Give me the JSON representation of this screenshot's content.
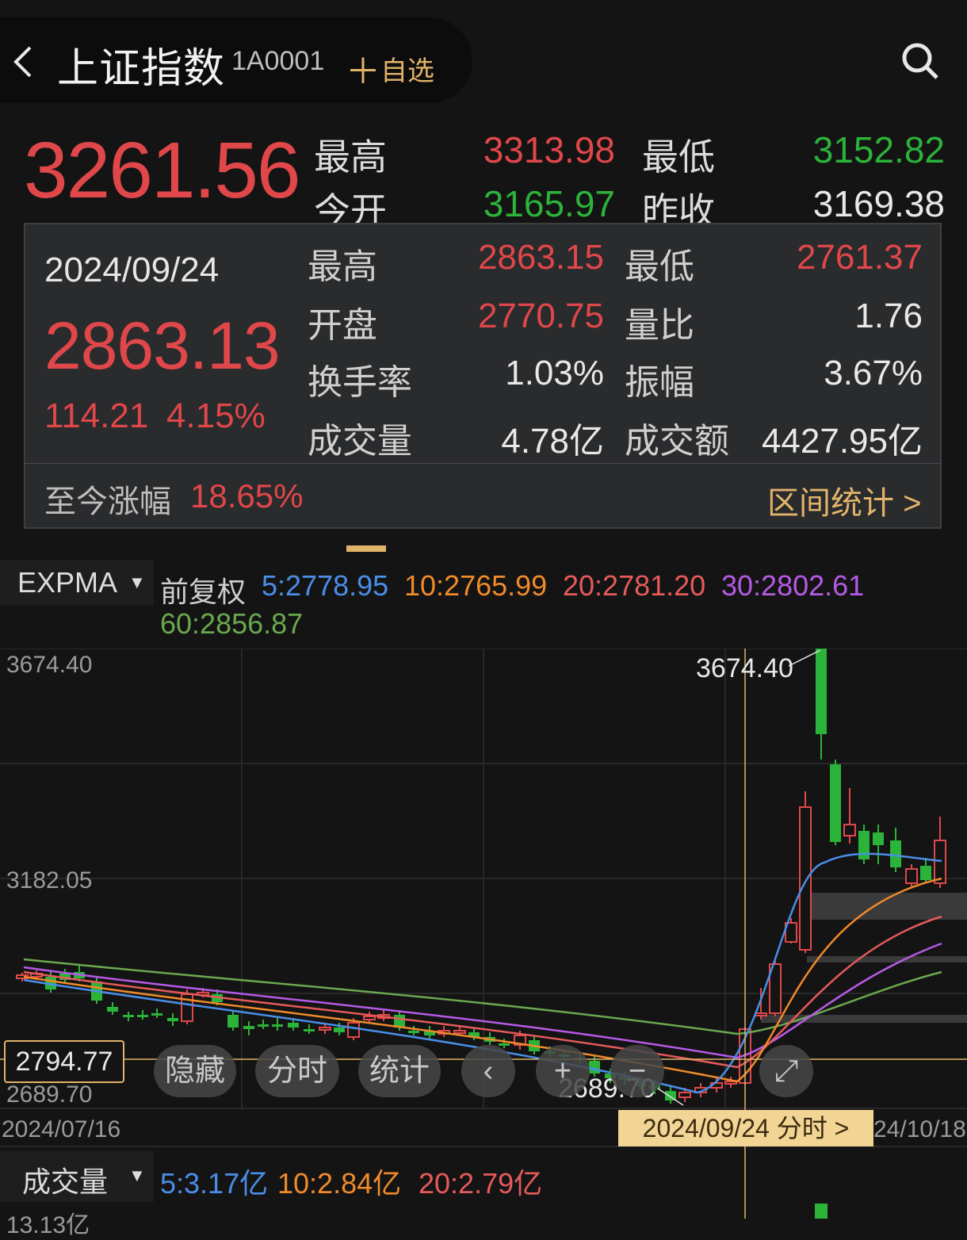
{
  "header": {
    "back_icon": "chevron-left-icon",
    "title": "上证指数",
    "code": "1A0001",
    "add_watch": "自选",
    "search_icon": "search-icon"
  },
  "quote": {
    "price": "3261.56",
    "high_label": "最高",
    "high": "3313.98",
    "low_label": "最低",
    "low": "3152.82",
    "open_label": "今开",
    "open": "3165.97",
    "prev_close_label": "昨收",
    "prev_close": "3169.38"
  },
  "popup": {
    "date": "2024/09/24",
    "close": "2863.13",
    "change": "114.21",
    "change_pct": "4.15%",
    "high_label": "最高",
    "high": "2863.15",
    "low_label": "最低",
    "low": "2761.37",
    "open_label": "开盘",
    "open": "2770.75",
    "vol_ratio_label": "量比",
    "vol_ratio": "1.76",
    "turnover_label": "换手率",
    "turnover": "1.03%",
    "amplitude_label": "振幅",
    "amplitude": "3.67%",
    "volume_label": "成交量",
    "volume": "4.78亿",
    "amount_label": "成交额",
    "amount": "4427.95亿",
    "gain_label": "至今涨幅",
    "gain": "18.65%",
    "range_stats": "区间统计 >"
  },
  "indicator": {
    "name": "EXPMA",
    "adjust": "前复权",
    "ma5": "5:2778.95",
    "ma10": "10:2765.99",
    "ma20": "20:2781.20",
    "ma30": "30:2802.61",
    "ma60": "60:2856.87"
  },
  "chart": {
    "y_top": "3674.40",
    "y_mid": "3182.05",
    "y_bottom": "2689.70",
    "crosshair_value": "2794.77",
    "max_label": "3674.40",
    "min_label": "2689.70",
    "x_start": "2024/07/16",
    "x_end": "24/10/18",
    "crosshair_date": "2024/09/24 分时 >"
  },
  "toolbar": {
    "hide": "隐藏",
    "intraday": "分时",
    "stats": "统计"
  },
  "volume": {
    "name": "成交量",
    "ma5": "5:3.17亿",
    "ma10": "10:2.84亿",
    "ma20": "20:2.79亿",
    "y_top": "13.13亿"
  },
  "colors": {
    "up": "#e0474a",
    "down": "#2bb33a",
    "ma5": "#4a8ee8",
    "ma10": "#f08a2a",
    "ma20": "#e65a5a",
    "ma30": "#b65ae6",
    "ma60": "#6aa84f",
    "accent": "#e2b36a"
  }
}
